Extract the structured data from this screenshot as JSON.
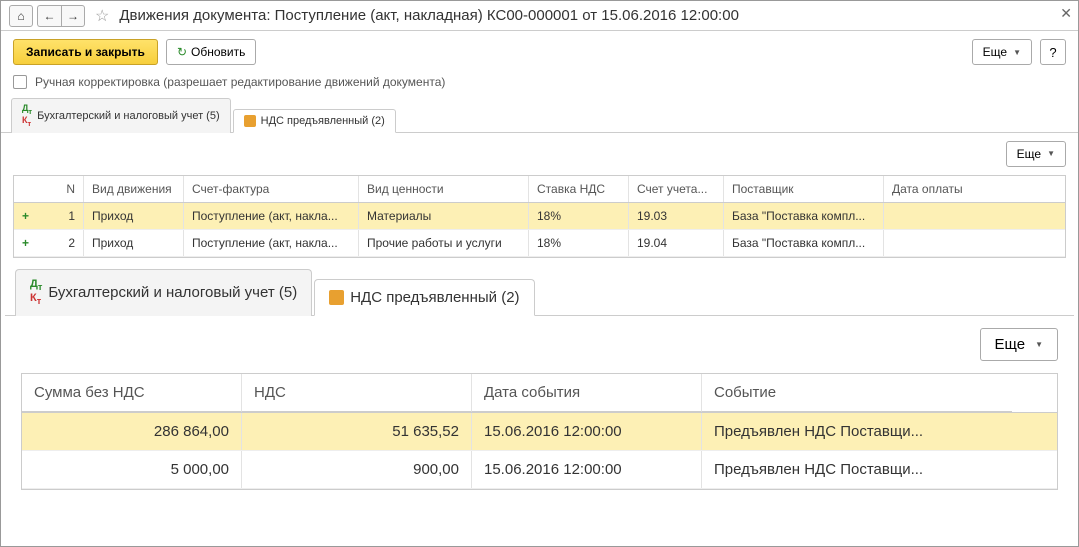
{
  "title": "Движения документа: Поступление (акт, накладная) КС00-000001 от 15.06.2016 12:00:00",
  "toolbar": {
    "save_close": "Записать и закрыть",
    "refresh": "Обновить",
    "more": "Еще",
    "help": "?"
  },
  "manual_correction": "Ручная корректировка (разрешает редактирование движений документа)",
  "tabs": {
    "accounting": "Бухгалтерский и налоговый учет (5)",
    "vat": "НДС предъявленный (2)"
  },
  "grid1": {
    "headers": {
      "n": "N",
      "vd": "Вид движения",
      "sf": "Счет-фактура",
      "vc": "Вид ценности",
      "st": "Ставка НДС",
      "su": "Счет учета...",
      "po": "Поставщик",
      "do": "Дата оплаты"
    },
    "rows": [
      {
        "n": "1",
        "vd": "Приход",
        "sf": "Поступление (акт, накла...",
        "vc": "Материалы",
        "st": "18%",
        "su": "19.03",
        "po": "База \"Поставка компл...",
        "do": ""
      },
      {
        "n": "2",
        "vd": "Приход",
        "sf": "Поступление (акт, накла...",
        "vc": "Прочие работы и услуги",
        "st": "18%",
        "su": "19.04",
        "po": "База \"Поставка компл...",
        "do": ""
      }
    ]
  },
  "grid2": {
    "headers": {
      "sum": "Сумма без НДС",
      "nds": "НДС",
      "dt": "Дата события",
      "ev": "Событие"
    },
    "rows": [
      {
        "sum": "286 864,00",
        "nds": "51 635,52",
        "dt": "15.06.2016 12:00:00",
        "ev": "Предъявлен НДС Поставщи..."
      },
      {
        "sum": "5 000,00",
        "nds": "900,00",
        "dt": "15.06.2016 12:00:00",
        "ev": "Предъявлен НДС Поставщи..."
      }
    ]
  }
}
